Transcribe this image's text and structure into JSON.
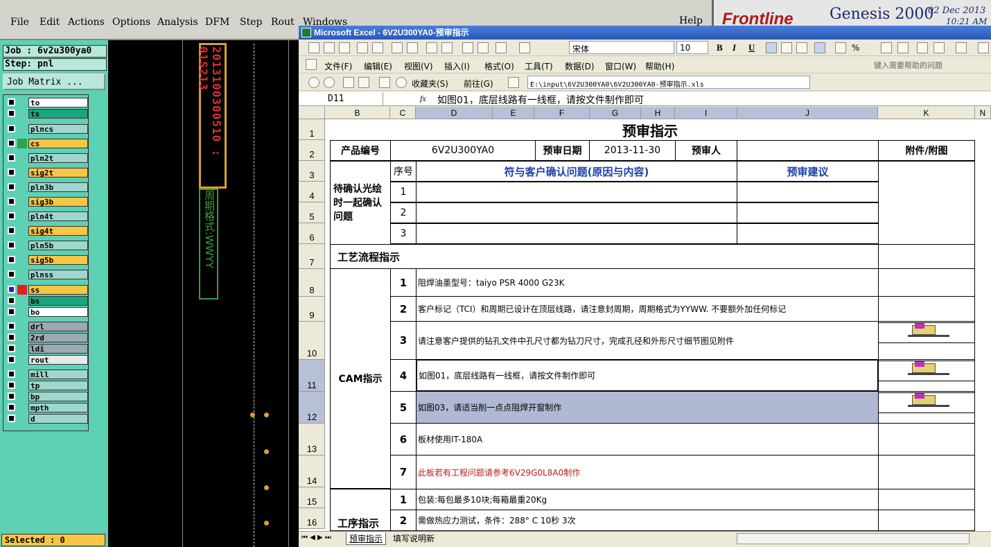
{
  "genesis": {
    "menu": [
      "File",
      "Edit",
      "Actions",
      "Options",
      "Analysis",
      "DFM",
      "Step",
      "Rout",
      "Windows",
      "Help"
    ],
    "logo": {
      "brand": "Frontline",
      "product": "Genesis 2000",
      "date": "02 Dec 2013",
      "time": "10:21 AM"
    },
    "job": "Job : 6v2u300ya0",
    "step": "Step: pnl",
    "job_matrix": "Job Matrix ...",
    "layers": [
      {
        "name": "to",
        "color": "#ffffff"
      },
      {
        "name": "ts",
        "color": "#1aa57c"
      },
      {
        "name": "plncs",
        "color": "#9fd6cd"
      },
      {
        "name": "cs",
        "color": "#f9c545"
      },
      {
        "name": "pln2t",
        "color": "#9fd6cd"
      },
      {
        "name": "sig2t",
        "color": "#f9c545"
      },
      {
        "name": "pln3b",
        "color": "#9fd6cd"
      },
      {
        "name": "sig3b",
        "color": "#f9c545"
      },
      {
        "name": "pln4t",
        "color": "#9fd6cd"
      },
      {
        "name": "sig4t",
        "color": "#f9c545"
      },
      {
        "name": "pln5b",
        "color": "#9fd6cd"
      },
      {
        "name": "sig5b",
        "color": "#f9c545"
      },
      {
        "name": "plnss",
        "color": "#9fd6cd"
      },
      {
        "name": "ss",
        "color": "#f9c545"
      },
      {
        "name": "bs",
        "color": "#1aa57c"
      },
      {
        "name": "bo",
        "color": "#ffffff"
      },
      {
        "name": "drl",
        "color": "#9aa9b2"
      },
      {
        "name": "2rd",
        "color": "#9aa9b2"
      },
      {
        "name": "ldi",
        "color": "#9aa9b2"
      },
      {
        "name": "rout",
        "color": "#e8e8e8"
      },
      {
        "name": "mill",
        "color": "#9fd6cd"
      },
      {
        "name": "tp",
        "color": "#9fd6cd"
      },
      {
        "name": "bp",
        "color": "#9fd6cd"
      },
      {
        "name": "mpth",
        "color": "#9fd6cd"
      },
      {
        "name": "d",
        "color": "#9fd6cd"
      }
    ],
    "selected": "Selected : 0",
    "canvas_text_vertical": "2013100300510 : 01S213",
    "canvas_text_vertical2": "周期格式:WWYY"
  },
  "excel": {
    "title": "Microsoft Excel - 6V2U300YA0-预审指示",
    "font_name": "宋体",
    "font_size": "10",
    "menu": [
      "文件(F)",
      "编辑(E)",
      "视图(V)",
      "插入(I)",
      "格式(O)",
      "工具(T)",
      "数据(D)",
      "窗口(W)",
      "帮助(H)"
    ],
    "help_box": "键入需要帮助的问题",
    "web_bar": {
      "favorites": "收藏夹(S)",
      "go": "前往(G)",
      "path": "E:\\input\\6V2U300YA0\\6V2U300YA0-预审指示.xls"
    },
    "name_box": "D11",
    "fx": "fx",
    "formula": "如图01，底层线路有一线框，请按文件制作即可",
    "columns": [
      "B",
      "C",
      "D",
      "E",
      "F",
      "G",
      "H",
      "I",
      "J",
      "K",
      "N"
    ],
    "rows": [
      "1",
      "2",
      "3",
      "4",
      "5",
      "6",
      "7",
      "8",
      "9",
      "10",
      "11",
      "12",
      "13",
      "14",
      "15",
      "16"
    ],
    "sheet": {
      "title": "预审指示",
      "product_label": "产品编号",
      "product_value": "6V2U300YA0",
      "date_label": "预审日期",
      "date_value": "2013-11-30",
      "reviewer_label": "预审人",
      "attach_label": "附件/附图",
      "seq_label": "序号",
      "issue_header": "符与客户确认问题(原因与内容)",
      "advice_header": "预审建议",
      "confirm_label": "待确认光绘时一起确认问题",
      "flow_label": "工艺流程指示",
      "cam_label": "CAM指示",
      "process_label": "工序指示",
      "nums": [
        "1",
        "2",
        "3"
      ],
      "cam_items": [
        {
          "n": "1",
          "t": "阻焊油墨型号：taiyo PSR 4000 G23K",
          "red": false
        },
        {
          "n": "2",
          "t": "客户标记（TCI）和周期已设计在顶层线路，请注意封周期，周期格式为YYWW. 不要额外加任何标记",
          "red": false
        },
        {
          "n": "3",
          "t": "请注意客户提供的钻孔文件中孔尺寸都为钻刀尺寸，完成孔径和外形尺寸细节图见附件",
          "red": false
        },
        {
          "n": "4",
          "t": "如图01，底层线路有一线框，请按文件制作即可",
          "red": false
        },
        {
          "n": "5",
          "t": "如图03，请适当削一点点阻焊开窗制作",
          "red": false
        },
        {
          "n": "6",
          "t": "板材使用IT-180A",
          "red": false
        },
        {
          "n": "7",
          "t": "此板若有工程问题请参考6V29G0L8A0制作",
          "red": true
        }
      ],
      "proc_items": [
        {
          "n": "1",
          "t": "包装:每包最多10块;每箱最重20Kg"
        },
        {
          "n": "2",
          "t": "需做热应力测试，条件：288° C 10秒 3次"
        }
      ]
    },
    "tabs": [
      "预审指示",
      "填写说明新"
    ]
  }
}
